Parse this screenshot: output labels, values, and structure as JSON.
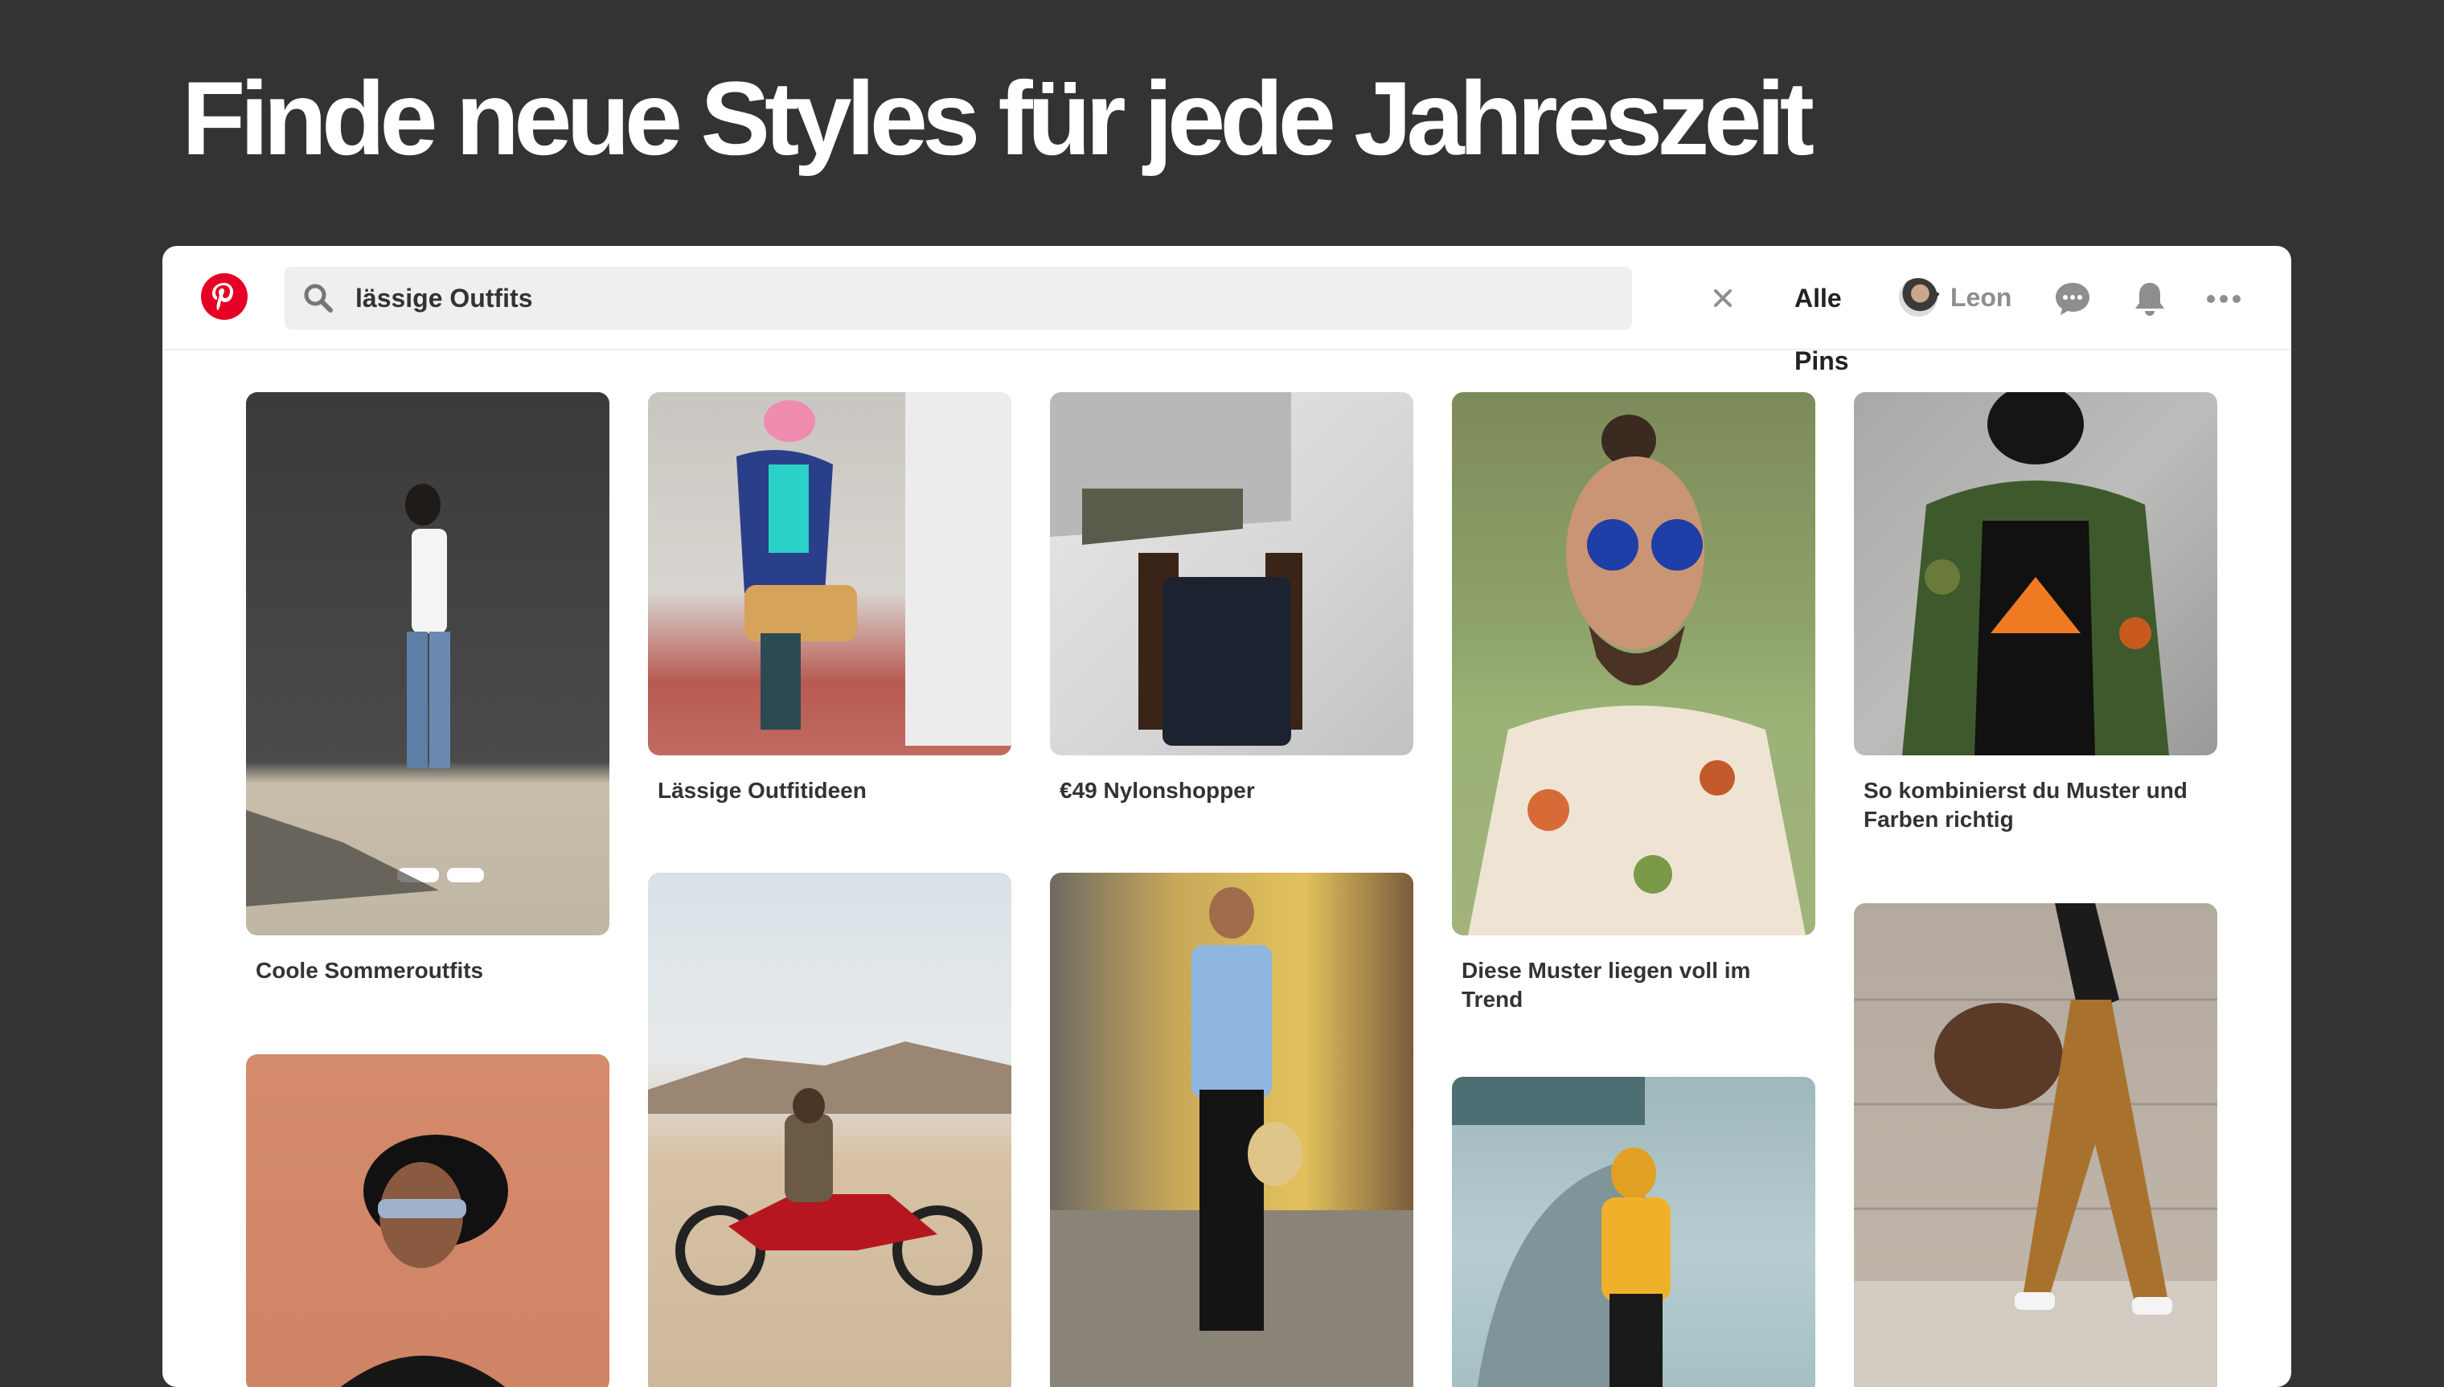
{
  "headline": "Finde neue Styles für jede Jahreszeit",
  "brand": {
    "logo_icon": "pinterest-logo-icon",
    "color": "#e60023"
  },
  "search": {
    "query": "lässige Outfits",
    "search_icon": "search-icon",
    "clear_icon": "close-icon",
    "filter_label": "Alle Pins",
    "filter_icon": "chevron-down-icon"
  },
  "user": {
    "name": "Leon",
    "avatar_icon": "avatar-icon"
  },
  "toolbar_icons": [
    "chat-bubble-icon",
    "bell-icon",
    "more-dots-icon"
  ],
  "pins": [
    {
      "title": "Coole Sommeroutfits",
      "image": "man-walking-white-tee-photo"
    },
    {
      "title": "",
      "image": "man-hat-sunglasses-portrait-photo"
    },
    {
      "title": "Lässige Outfitideen",
      "image": "man-reading-floral-jacket-photo"
    },
    {
      "title": "",
      "image": "man-motorcycle-desert-photo"
    },
    {
      "title": "€49 Nylonshopper",
      "image": "man-sitting-black-bag-photo"
    },
    {
      "title": "",
      "image": "man-suspenders-straw-hat-photo"
    },
    {
      "title": "Diese Muster liegen voll im Trend",
      "image": "man-floral-shirt-sunglasses-photo"
    },
    {
      "title": "",
      "image": "man-yellow-hoodie-photo"
    },
    {
      "title": "So kombinierst du Muster und Farben richtig",
      "image": "man-camo-jacket-photo"
    },
    {
      "title": "",
      "image": "man-leather-bag-walking-photo"
    }
  ]
}
